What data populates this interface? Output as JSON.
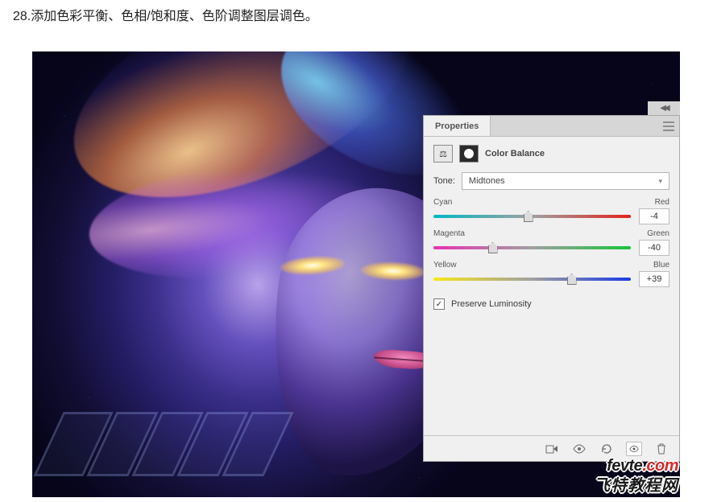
{
  "instruction": "28.添加色彩平衡、色相/饱和度、色阶调整图层调色。",
  "panel": {
    "tab_label": "Properties",
    "adjustment_symbol": "⚖",
    "adjustment_name": "Color Balance",
    "tone_label": "Tone:",
    "tone_value": "Midtones",
    "sliders": [
      {
        "left": "Cyan",
        "right": "Red",
        "value": "-4",
        "pos": 48
      },
      {
        "left": "Magenta",
        "right": "Green",
        "value": "-40",
        "pos": 30
      },
      {
        "left": "Yellow",
        "right": "Blue",
        "value": "+39",
        "pos": 70
      }
    ],
    "preserve_label": "Preserve Luminosity",
    "preserve_checked": "✓"
  },
  "watermark": {
    "line1a": "fevte",
    "line1b": ".",
    "line1c": "com",
    "line2": "飞特教程网"
  }
}
